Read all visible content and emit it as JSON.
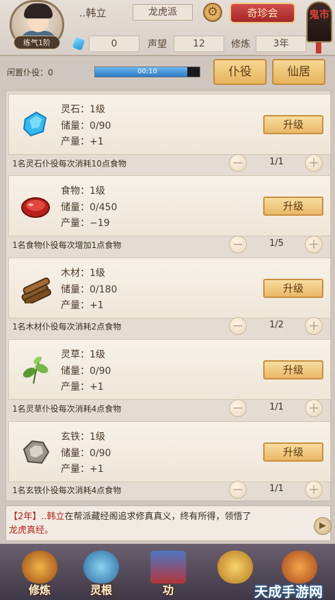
{
  "player": {
    "name": "..韩立",
    "rank": "练气1阶",
    "sect": "龙虎派"
  },
  "header": {
    "shop_label": "奇珍会",
    "market_label": "鬼市",
    "spirit_stones": "0",
    "reputation_label": "声望",
    "reputation_value": "12",
    "cultivation_label": "修炼",
    "cultivation_value": "3年"
  },
  "idle": {
    "label": "闲置仆役：0",
    "timer": "00:10",
    "progress": 0.88
  },
  "tabs": {
    "servants": "仆役",
    "immortal_residence": "仙居"
  },
  "resources": [
    {
      "icon": "spirit-stone-icon",
      "name": "灵石：1级",
      "storage": "储量：0/90",
      "output": "产量：+1",
      "upgrade": "升级",
      "rule": "1名灵石仆役每次消耗10点食物",
      "count": "1/1"
    },
    {
      "icon": "food-meat-icon",
      "name": "食物：1级",
      "storage": "储量：0/450",
      "output": "产量：−19",
      "upgrade": "升级",
      "rule": "1名食物仆役每次增加1点食物",
      "count": "1/5"
    },
    {
      "icon": "wood-logs-icon",
      "name": "木材：1级",
      "storage": "储量：0/180",
      "output": "产量：+1",
      "upgrade": "升级",
      "rule": "1名木材仆役每次消耗2点食物",
      "count": "1/2"
    },
    {
      "icon": "spirit-herb-icon",
      "name": "灵草：1级",
      "storage": "储量：0/90",
      "output": "产量：+1",
      "upgrade": "升级",
      "rule": "1名灵草仆役每次消耗4点食物",
      "count": "1/1"
    },
    {
      "icon": "black-iron-icon",
      "name": "玄铁：1级",
      "storage": "储量：0/90",
      "output": "产量：+1",
      "upgrade": "升级",
      "rule": "1名玄铁仆役每次消耗4点食物",
      "count": "1/1"
    }
  ],
  "log": {
    "year": "【2年】",
    "name": "..韩立",
    "text": "在帮派藏经阁追求修真真义，终有所得，领悟了",
    "skill": "龙虎真经。"
  },
  "nav": {
    "cultivate": "修炼",
    "spirit_root": "灵根",
    "skills": "功",
    "item4": "",
    "item5": ""
  },
  "watermark": "天成手游网",
  "colors": {
    "accent_gold": "#e9b867",
    "shop_red": "#a42828",
    "progress_blue": "#2b79c7"
  }
}
